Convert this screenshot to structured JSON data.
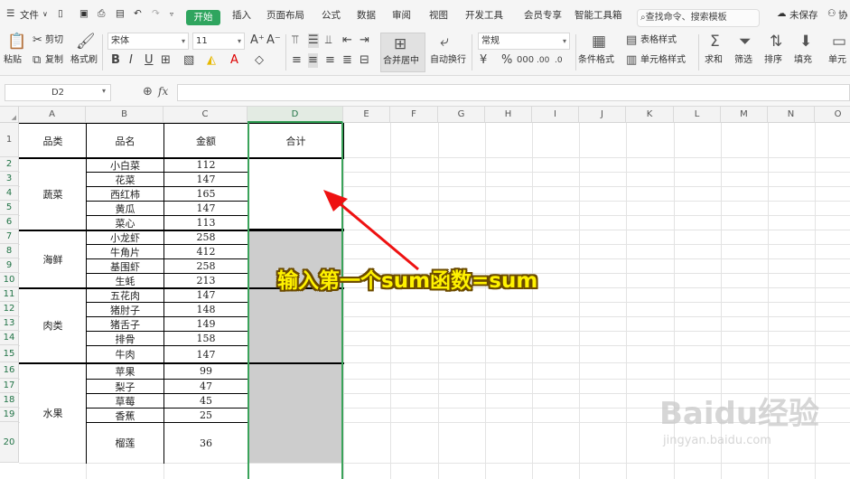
{
  "menu": {
    "file": "文件",
    "tabs": [
      "开始",
      "插入",
      "页面布局",
      "公式",
      "数据",
      "审阅",
      "视图",
      "开发工具",
      "会员专享",
      "智能工具箱"
    ],
    "search_placeholder": "查找命令、搜索模板",
    "unsaved": "未保存",
    "collab": "协"
  },
  "ribbon": {
    "paste": "粘贴",
    "cut": "剪切",
    "copy": "复制",
    "format_painter": "格式刷",
    "font_name": "宋体",
    "font_size": "11",
    "merge_center": "合并居中",
    "wrap_text": "自动换行",
    "number_format": "常规",
    "conditional_format": "条件格式",
    "table_style": "表格样式",
    "cell_style": "单元格样式",
    "sum": "求和",
    "filter": "筛选",
    "sort": "排序",
    "fill": "填充",
    "cell": "单元"
  },
  "formula_bar": {
    "name_box": "D2",
    "fx": "fx",
    "formula": ""
  },
  "sheet": {
    "columns": [
      "A",
      "B",
      "C",
      "D",
      "E",
      "F",
      "G",
      "H",
      "I",
      "J",
      "K",
      "L",
      "M",
      "N",
      "O"
    ],
    "rows": [
      "1",
      "2",
      "3",
      "4",
      "5",
      "6",
      "7",
      "8",
      "9",
      "10",
      "11",
      "12",
      "13",
      "14",
      "15",
      "16",
      "17",
      "18",
      "19",
      "20"
    ],
    "headers": [
      "品类",
      "品名",
      "金额",
      "合计"
    ],
    "categories": [
      "蔬菜",
      "海鲜",
      "肉类",
      "水果"
    ],
    "names": [
      "小白菜",
      "花菜",
      "西红柿",
      "黄瓜",
      "菜心",
      "小龙虾",
      "牛角片",
      "基围虾",
      "生蚝",
      "五花肉",
      "猪肘子",
      "猪舌子",
      "排骨",
      "牛肉",
      "苹果",
      "梨子",
      "草莓",
      "香蕉",
      "榴莲"
    ],
    "amounts": [
      "112",
      "147",
      "165",
      "147",
      "113",
      "258",
      "412",
      "258",
      "213",
      "147",
      "148",
      "149",
      "158",
      "147",
      "99",
      "47",
      "45",
      "25",
      "36"
    ]
  },
  "annotation": "输入第一个sum函数=sum",
  "watermark": {
    "main": "Baidu经验",
    "sub": "jingyan.baidu.com"
  },
  "colors": {
    "accent": "#2fa55f",
    "selection": "#3aa35a",
    "merged_fill": "#cdcdcd",
    "callout_text": "#fff200",
    "arrow": "#ee1111"
  }
}
